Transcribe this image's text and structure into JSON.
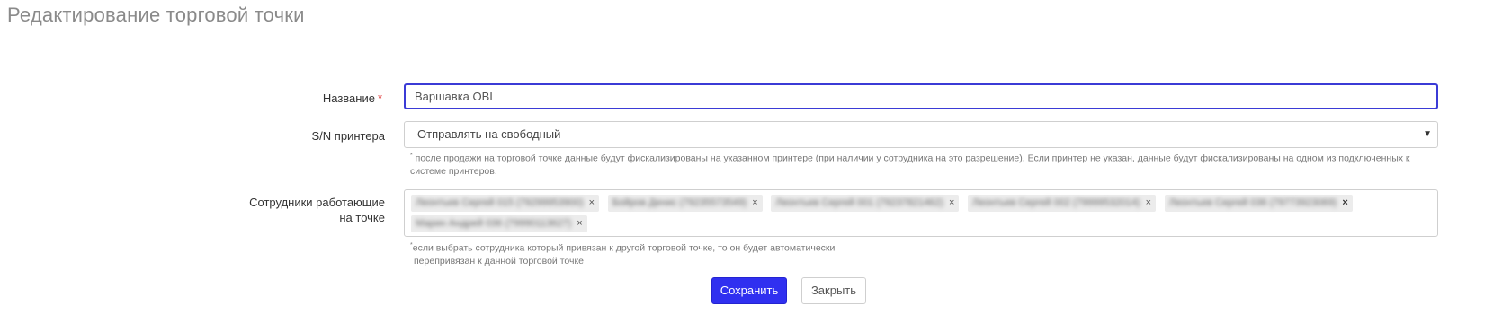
{
  "page": {
    "title": "Редактирование торговой точки"
  },
  "form": {
    "name": {
      "label": "Название",
      "required_mark": "*",
      "value": "Варшавка OBI"
    },
    "printer": {
      "label": "S/N принтера",
      "selected": "Отправлять на свободный",
      "arrow_icon": "caret-down-icon",
      "hint_mark": "*",
      "hint": "после продажи на торговой точке данные будут фискализированы на указанном принтере (при наличии у сотрудника на это разрешение). Если принтер не указан, данные будут фискализированы на одном из подключенных к системе принтеров."
    },
    "employees": {
      "label_line1": "Сотрудники работающие",
      "label_line2": "на точке",
      "tags": [
        "Леонтьев Сергей 015 (79299953900)",
        "Бойров Денис (79235573549)",
        "Леонтьев Сергей 001 (79237821462)",
        "Леонтьев Сергей 002 (79999532014)",
        "Леонтьев Сергей 036 (79773923069)",
        "Марин Андрей 036 (79990113627)"
      ],
      "remove_glyph": "×",
      "hint_mark": "*",
      "hint_line1": "если выбрать сотрудника который привязан к другой торговой точке, то он будет автоматически",
      "hint_line2": "перепривязан к данной торговой точке"
    }
  },
  "actions": {
    "save_label": "Сохранить",
    "close_label": "Закрыть"
  },
  "colors": {
    "primary": "#3030f0",
    "focus_border": "#3b3bd6",
    "required": "#e03a3a"
  }
}
